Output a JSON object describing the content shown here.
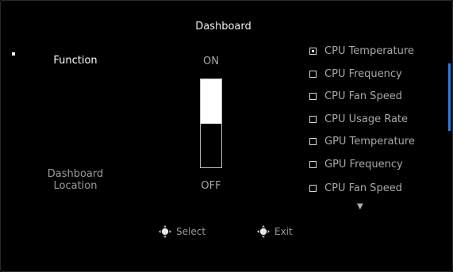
{
  "title": "Dashboard",
  "function_label": "Function",
  "location_label": "Dashboard Location",
  "toggle": {
    "on_label": "ON",
    "off_label": "OFF",
    "value": "ON",
    "fill_fraction": 0.5
  },
  "options": [
    {
      "label": "CPU Temperature",
      "checked": true
    },
    {
      "label": "CPU Frequency",
      "checked": false
    },
    {
      "label": "CPU Fan Speed",
      "checked": false
    },
    {
      "label": "CPU Usage Rate",
      "checked": false
    },
    {
      "label": "GPU Temperature",
      "checked": false
    },
    {
      "label": "GPU Frequency",
      "checked": false
    },
    {
      "label": "CPU Fan Speed",
      "checked": false
    }
  ],
  "more_indicator": "▼",
  "hints": {
    "select_label": "Select",
    "exit_label": "Exit",
    "select_icon": "joystick-press-icon",
    "exit_icon": "joystick-move-icon"
  },
  "colors": {
    "background": "#000000",
    "scroll_accent": "#2f7fd6"
  }
}
